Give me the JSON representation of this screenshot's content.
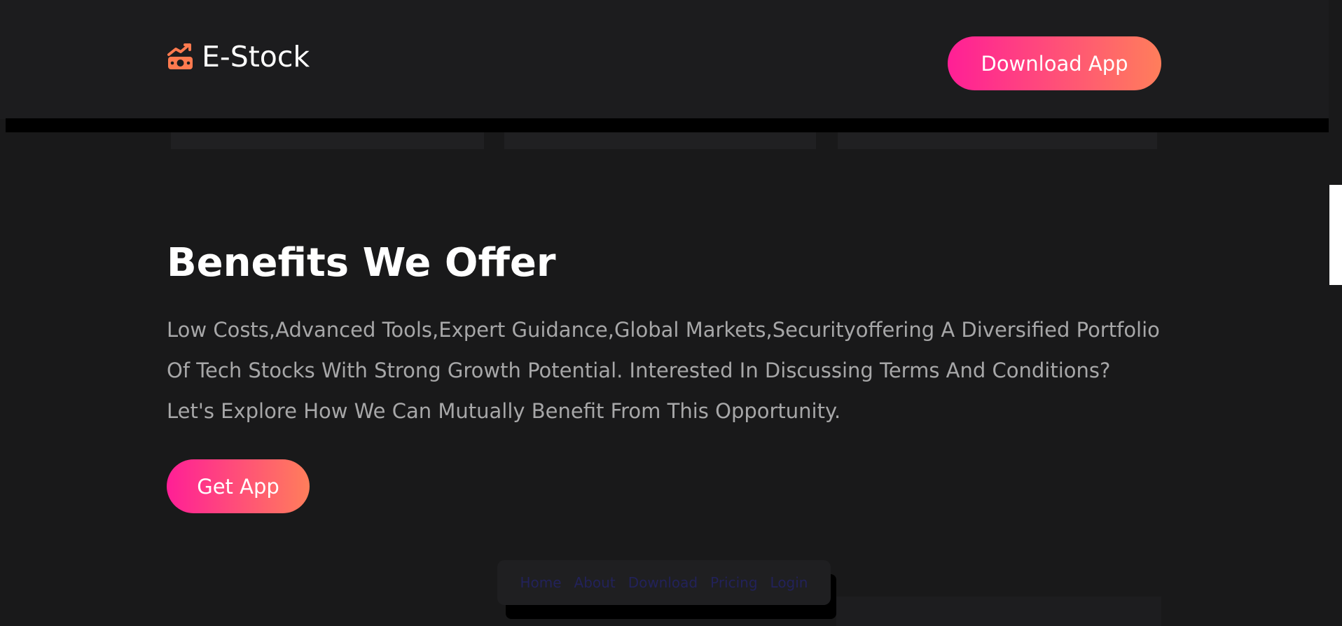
{
  "brand": {
    "name": "E-Stock",
    "icon": "chart-money-icon",
    "icon_color": "#ff7a4f"
  },
  "header": {
    "download_label": "Download App"
  },
  "benefits": {
    "title": "Benefits We Offer",
    "description": "Low Costs,Advanced Tools,Expert Guidance,Global Markets,Securityoffering A Diversified Portfolio Of Tech Stocks With Strong Growth Potential. Interested In Discussing Terms And Conditions? Let's Explore How We Can Mutually Benefit From This Opportunity.",
    "cta_label": "Get App"
  },
  "footer_nav": {
    "items": [
      {
        "label": "Home"
      },
      {
        "label": "About"
      },
      {
        "label": "Download"
      },
      {
        "label": "Pricing"
      },
      {
        "label": "Login"
      }
    ]
  },
  "colors": {
    "background": "#19191a",
    "header": "#1c1c1e",
    "gradient_start": "#ff1f96",
    "gradient_end": "#ff7e5b",
    "muted_text": "#a7a7a8",
    "nav_link": "#22225a"
  }
}
